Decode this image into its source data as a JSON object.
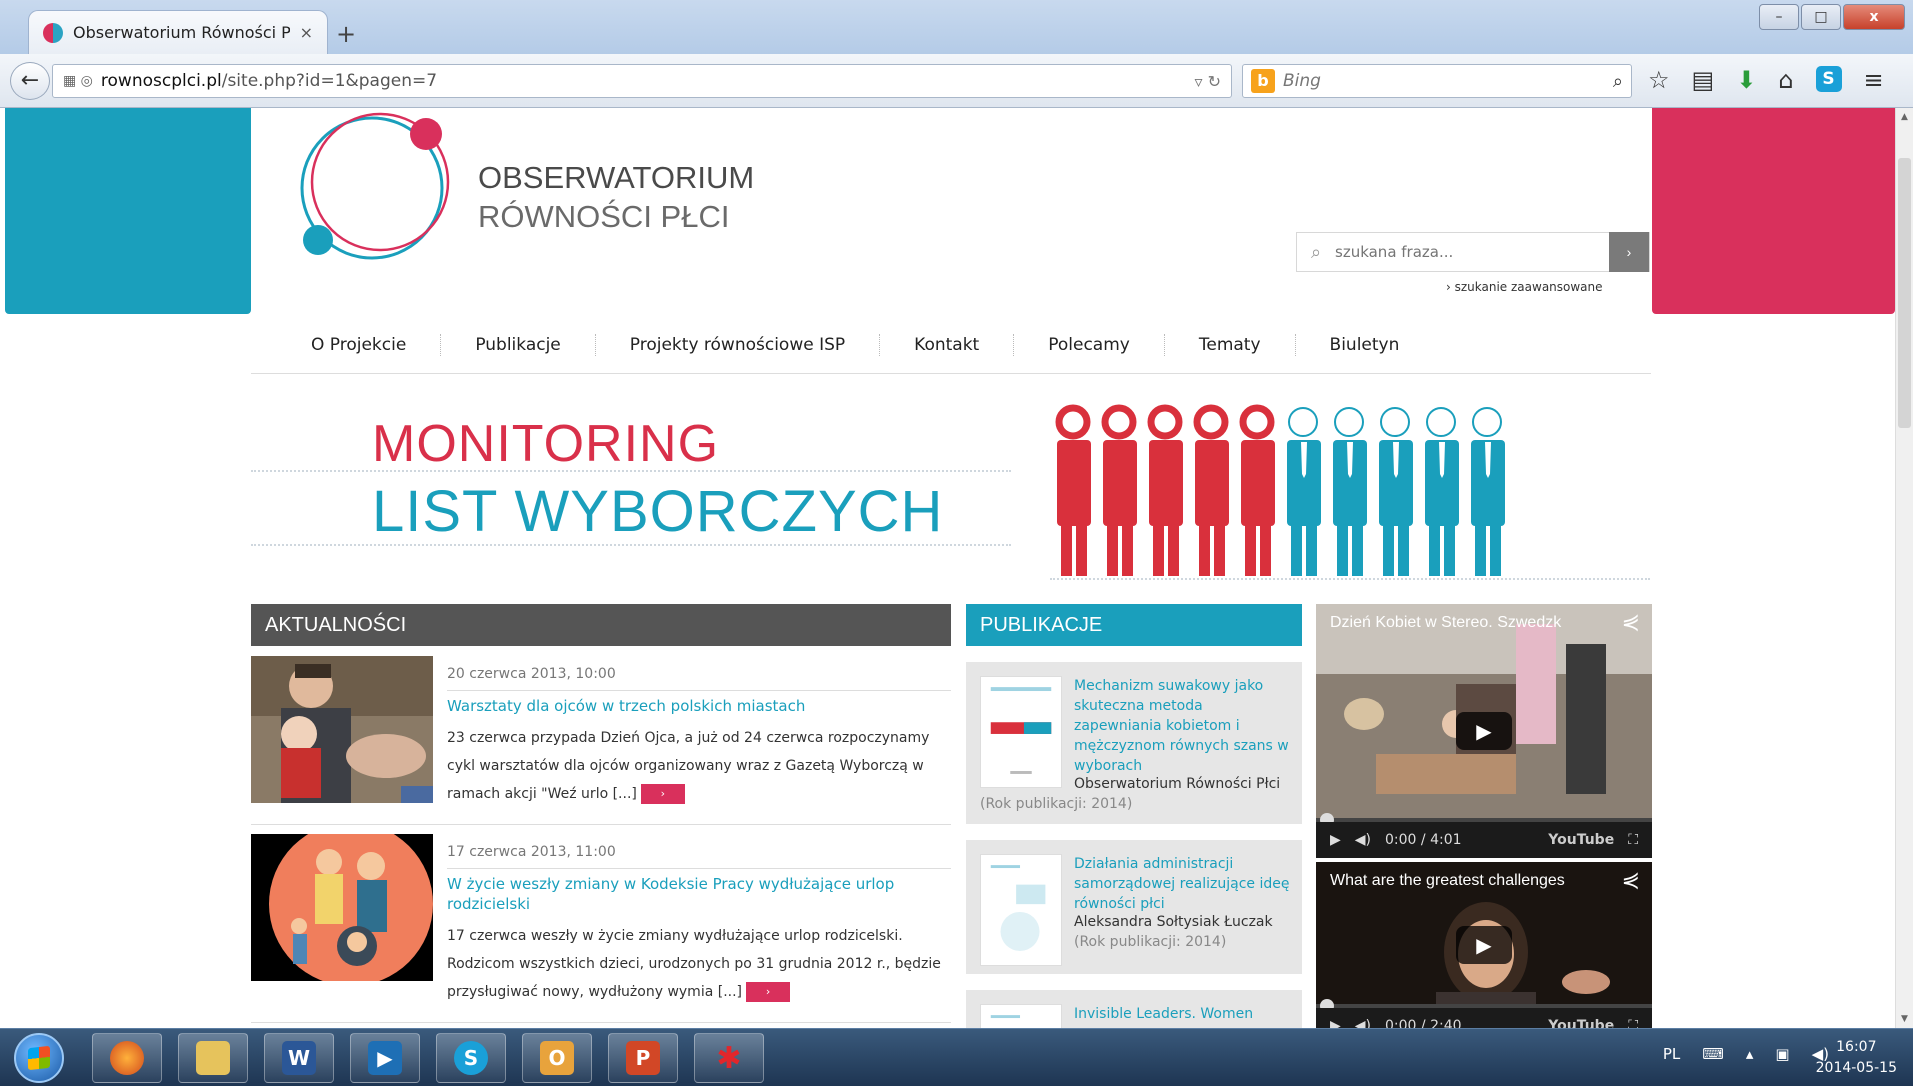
{
  "browser": {
    "tab_title": "Obserwatorium Równości Płci ...",
    "tab_close": "×",
    "new_tab": "+",
    "url_domain": "rownoscplci.pl",
    "url_path": "/site.php?id=1&pagen=7",
    "search_engine": "Bing",
    "window_buttons": [
      "–",
      "□",
      "x"
    ]
  },
  "site": {
    "logo_line1": "OBSERWATORIUM",
    "logo_line2": "RÓWNOŚCI PŁCI",
    "search_placeholder": "szukana fraza...",
    "search_button": "›",
    "advanced_search": "› szukanie zaawansowane",
    "nav": [
      "O Projekcie",
      "Publikacje",
      "Projekty równościowe ISP",
      "Kontakt",
      "Polecamy",
      "Tematy",
      "Biuletyn"
    ],
    "banner_line1": "MONITORING",
    "banner_line2": "LIST WYBORCZYCH"
  },
  "colors": {
    "teal": "#1a9fbc",
    "pink": "#d9305c",
    "red_figures": "#d9303c",
    "dark_header": "#555555"
  },
  "news": {
    "header": "AKTUALNOŚCI",
    "more_label": "›",
    "items": [
      {
        "date": "20 czerwca 2013, 10:00",
        "title": "Warsztaty dla ojców w trzech polskich miastach",
        "text": "23 czerwca przypada Dzień Ojca, a już od 24 czerwca rozpoczynamy cykl warsztatów dla ojców organizowany wraz z Gazetą Wyborczą w ramach akcji \"Weź urlo [...]"
      },
      {
        "date": "17 czerwca 2013, 11:00",
        "title": "W życie weszły zmiany w Kodeksie Pracy wydłużające urlop rodzicielski",
        "text": "17 czerwca weszły w życie zmiany wydłużające urlop rodzicelski. Rodzicom wszystkich dzieci, urodzonych po 31 grudnia 2012 r., będzie przysługiwać nowy, wydłużony wymia [...]"
      }
    ]
  },
  "publications": {
    "header": "PUBLIKACJE",
    "items": [
      {
        "title": "Mechanizm suwakowy jako skuteczna metoda zapewniania kobietom i mężczyznom równych szans w wyborach",
        "author": "Obserwatorium Równości Płci",
        "year": "(Rok publikacji: 2014)"
      },
      {
        "title": "Działania administracji samorządowej realizujące ideę równości płci",
        "author": "Aleksandra Sołtysiak Łuczak",
        "year": "(Rok publikacji: 2014)"
      },
      {
        "title": "Invisible Leaders. Women",
        "author": "",
        "year": ""
      }
    ]
  },
  "videos": [
    {
      "title": "Dzień Kobiet w Stereo. Szwedzk",
      "time": "0:00 / 4:01",
      "yt": "YouTube"
    },
    {
      "title": "What are the greatest challenges",
      "time": "0:00 / 2:40",
      "yt": "YouTube"
    }
  ],
  "taskbar": {
    "lang": "PL",
    "time": "16:07",
    "date": "2014-05-15"
  }
}
